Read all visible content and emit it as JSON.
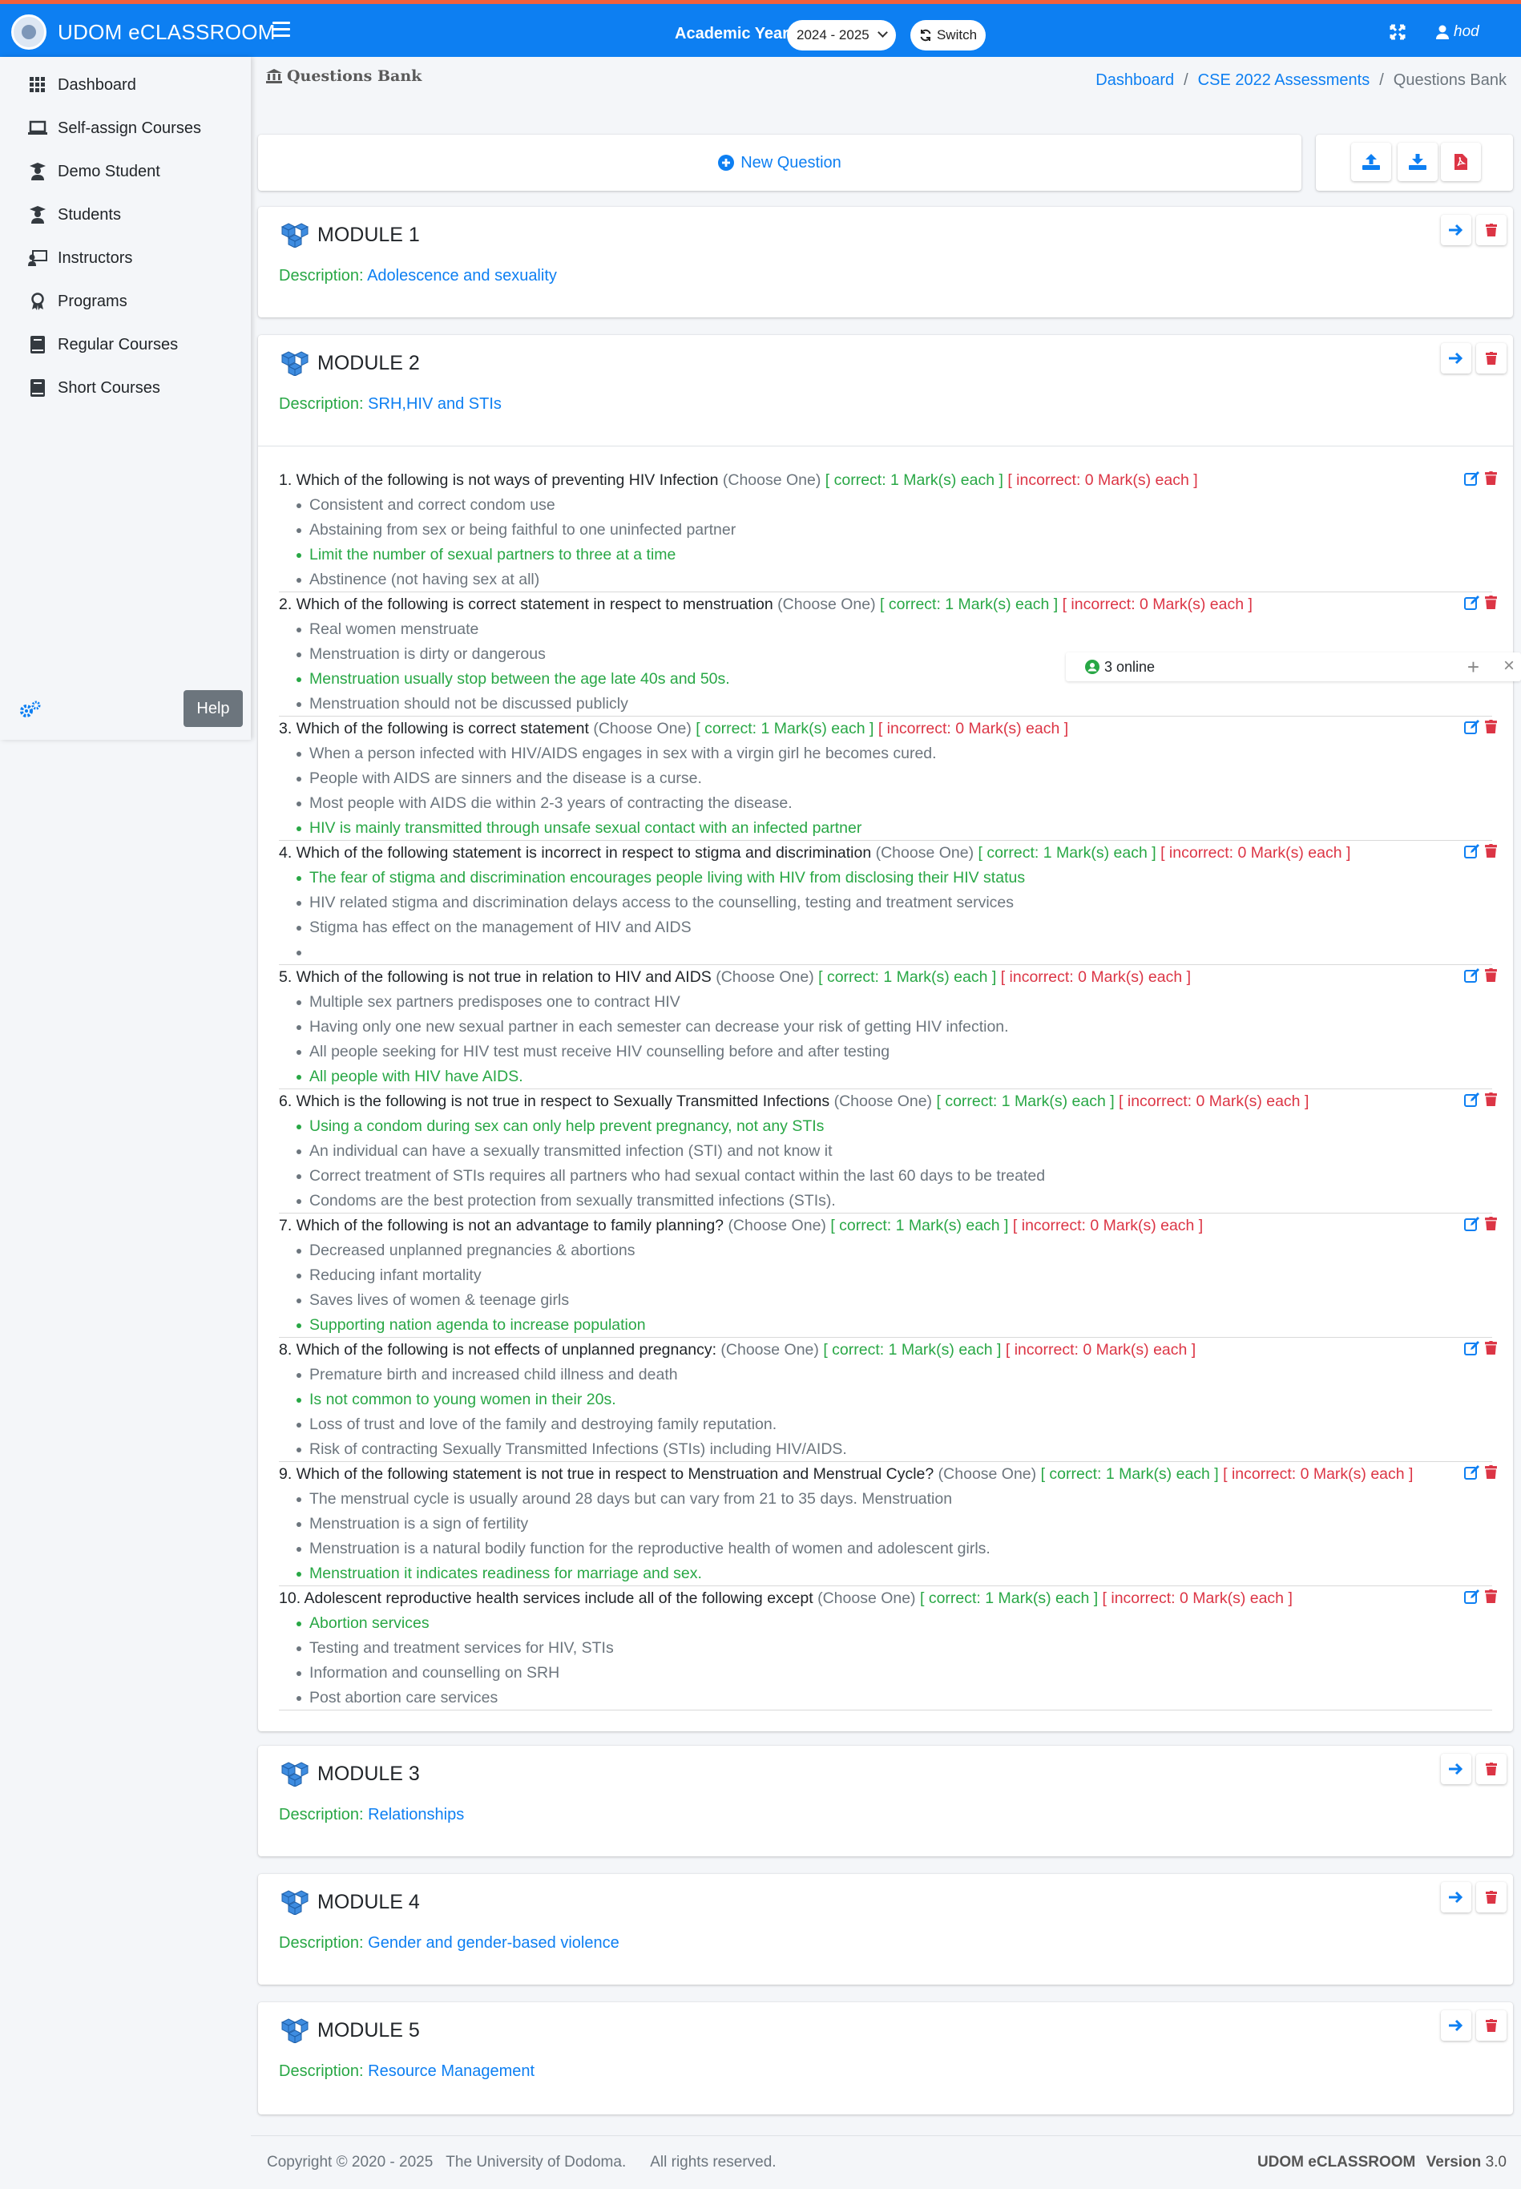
{
  "app": {
    "brand": "UDOM eCLASSROOM"
  },
  "topbar": {
    "academic_year_label": "Academic Year",
    "academic_year_value": "2024 - 2025",
    "switch_label": "Switch",
    "user_name": "hod",
    "icons": [
      "menu-icon",
      "expand-icon",
      "user-icon",
      "sync-icon"
    ]
  },
  "sidebar": {
    "items": [
      {
        "label": "Dashboard",
        "icon": "grid-icon"
      },
      {
        "label": "Self-assign Courses",
        "icon": "laptop-icon"
      },
      {
        "label": "Demo Student",
        "icon": "graduate-icon"
      },
      {
        "label": "Students",
        "icon": "graduate-icon"
      },
      {
        "label": "Instructors",
        "icon": "teacher-icon"
      },
      {
        "label": "Programs",
        "icon": "award-icon"
      },
      {
        "label": "Regular Courses",
        "icon": "book-icon"
      },
      {
        "label": "Short Courses",
        "icon": "book-icon"
      }
    ],
    "help_label": "Help"
  },
  "page": {
    "title": "Questions Bank",
    "breadcrumb": [
      "Dashboard",
      "CSE 2022 Assessments",
      "Questions Bank"
    ],
    "new_question_label": "New Question"
  },
  "description_label": "Description:",
  "modules": [
    {
      "title": "MODULE 1",
      "description": "Adolescence and sexuality"
    },
    {
      "title": "MODULE 2",
      "description": "SRH,HIV and STIs"
    },
    {
      "title": "MODULE 3",
      "description": "Relationships"
    },
    {
      "title": "MODULE 4",
      "description": "Gender and gender-based violence"
    },
    {
      "title": "MODULE 5",
      "description": "Resource Management"
    }
  ],
  "question_meta": {
    "type": "(Choose One)",
    "correct": "[ correct: 1 Mark(s) each ]",
    "incorrect": "[ incorrect: 0 Mark(s) each ]"
  },
  "questions": [
    {
      "text": "1. Which of the following is not ways of preventing HIV Infection",
      "options": [
        "Consistent and correct condom use",
        "Abstaining from sex or being faithful to one uninfected partner",
        "Limit the number of sexual partners to three at a time",
        "Abstinence (not having sex at all)"
      ],
      "correct_index": 2
    },
    {
      "text": "2. Which of the following is correct statement in respect to menstruation",
      "options": [
        "Real women menstruate",
        "Menstruation is dirty or dangerous",
        "Menstruation usually stop between the age late 40s and 50s.",
        "Menstruation should not be discussed publicly"
      ],
      "correct_index": 2
    },
    {
      "text": "3. Which of the following is correct statement",
      "options": [
        "When a person infected with HIV/AIDS engages in sex with a virgin girl he becomes cured.",
        "People with AIDS are sinners and the disease is a curse.",
        "Most people with AIDS die within 2-3 years of contracting the disease.",
        "HIV is mainly transmitted through unsafe sexual contact with an infected partner"
      ],
      "correct_index": 3
    },
    {
      "text": "4. Which of the following statement is incorrect in respect to stigma and discrimination",
      "options": [
        "The fear of stigma and discrimination encourages people living with HIV from disclosing their HIV status",
        "HIV related stigma and discrimination delays access to the counselling, testing and treatment services",
        "Stigma has effect on the management of HIV and AIDS",
        ""
      ],
      "correct_index": 0
    },
    {
      "text": "5. Which of the following is not true in relation to HIV and AIDS",
      "options": [
        "Multiple sex partners predisposes one to contract HIV",
        "Having only one new sexual partner in each semester can decrease your risk of getting HIV infection.",
        "All people seeking for HIV test must receive HIV counselling before and after testing",
        "All people with HIV have AIDS."
      ],
      "correct_index": 3
    },
    {
      "text": "6. Which is the following is not true in respect to Sexually Transmitted Infections",
      "options": [
        "Using a condom during sex can only help prevent pregnancy, not any STIs",
        "An individual can have a sexually transmitted infection (STI) and not know it",
        "Correct treatment of STIs requires all partners who had sexual contact within the last 60 days to be treated",
        "Condoms are the best protection from sexually transmitted infections (STIs)."
      ],
      "correct_index": 0
    },
    {
      "text": "7. Which of the following is not an advantage to family planning?",
      "options": [
        "Decreased unplanned pregnancies & abortions",
        "Reducing infant mortality",
        "Saves lives of women & teenage girls",
        "Supporting nation agenda to increase population"
      ],
      "correct_index": 3
    },
    {
      "text": "8. Which of the following is not effects of unplanned pregnancy:",
      "options": [
        "Premature birth and increased child illness and death",
        "Is not common to young women in their 20s.",
        "Loss of trust and love of the family and destroying family reputation.",
        "Risk of contracting Sexually Transmitted Infections (STIs) including HIV/AIDS."
      ],
      "correct_index": 1
    },
    {
      "text": "9. Which of the following statement is not true in respect to Menstruation and Menstrual Cycle?",
      "options": [
        "The menstrual cycle is usually around 28 days but can vary from 21 to 35 days. Menstruation",
        "Menstruation is a sign of fertility",
        "Menstruation is a natural bodily function for the reproductive health of women and adolescent girls.",
        "Menstruation it indicates readiness for marriage and sex."
      ],
      "correct_index": 3
    },
    {
      "text": "10. Adolescent reproductive health services include all of the following except",
      "options": [
        "Abortion services",
        "Testing and treatment services for HIV, STIs",
        "Information and counselling on SRH",
        "Post abortion care services"
      ],
      "correct_index": 0
    }
  ],
  "online_widget": {
    "label": "3 online"
  },
  "footer": {
    "copyright": "Copyright © 2020 - 2025",
    "org": "The University of Dodoma.",
    "rights": "All rights reserved.",
    "product": "UDOM eCLASSROOM",
    "version_label": "Version",
    "version": "3.0"
  },
  "colors": {
    "primary": "#0d7ff2",
    "success": "#28a745",
    "danger": "#dc3545",
    "topbar_accent": "#f2603c"
  }
}
